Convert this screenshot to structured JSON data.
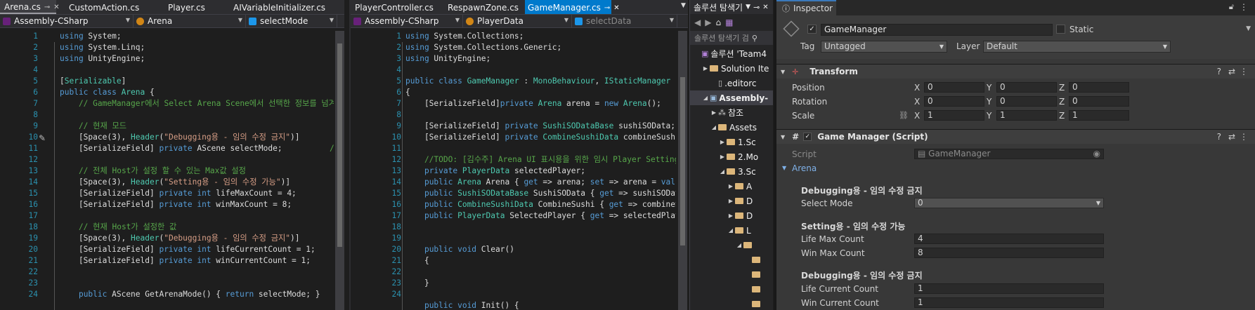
{
  "left_editor": {
    "tabs": [
      {
        "label": "Arena.cs",
        "active": true
      },
      {
        "label": "CustomAction.cs"
      },
      {
        "label": "Player.cs"
      },
      {
        "label": "AIVariableInitializer.cs"
      }
    ],
    "nav": {
      "project": "Assembly-CSharp",
      "class": "Arena",
      "member": "selectMode"
    },
    "line_numbers": [
      "1",
      "2",
      "3",
      "4",
      "5",
      "6",
      "7",
      "8",
      "9",
      "10",
      "11",
      "12",
      "13",
      "14",
      "15",
      "16",
      "17",
      "18",
      "19",
      "20",
      "21",
      "22",
      "23",
      "24"
    ],
    "lines": [
      [
        [
          "using",
          "kw"
        ],
        [
          " System;",
          "t"
        ]
      ],
      [
        [
          "using",
          "kw"
        ],
        [
          " System.Linq;",
          "t"
        ]
      ],
      [
        [
          "using",
          "kw"
        ],
        [
          " UnityEngine;",
          "t"
        ]
      ],
      [
        [
          "",
          "t"
        ]
      ],
      [
        [
          "[",
          "t"
        ],
        [
          "Serializable",
          "ty"
        ],
        [
          "]",
          "t"
        ]
      ],
      [
        [
          "public class ",
          "kw"
        ],
        [
          "Arena",
          "ty"
        ],
        [
          " {",
          "t"
        ]
      ],
      [
        [
          "    // GameManager에서 Select Arena Scene에서 선택한 정보를 넘겨",
          "cm"
        ]
      ],
      [
        [
          "",
          "t"
        ]
      ],
      [
        [
          "    // 현재 모드",
          "cm"
        ]
      ],
      [
        [
          "    [Space(3), ",
          "t"
        ],
        [
          "Header",
          "ty"
        ],
        [
          "(",
          "t"
        ],
        [
          "\"Debugging용 - 임의 수정 금지\"",
          "st"
        ],
        [
          ")]",
          "t"
        ]
      ],
      [
        [
          "    [SerializeField] ",
          "t"
        ],
        [
          "private",
          "kw"
        ],
        [
          " AScene selectMode;          ",
          "t"
        ],
        [
          "// 현재",
          "cm"
        ]
      ],
      [
        [
          "",
          "t"
        ]
      ],
      [
        [
          "    // 전체 Host가 설정 할 수 있는 Max값 설정",
          "cm"
        ]
      ],
      [
        [
          "    [Space(3), ",
          "t"
        ],
        [
          "Header",
          "ty"
        ],
        [
          "(",
          "t"
        ],
        [
          "\"Setting용 - 임의 수정 가능\"",
          "st"
        ],
        [
          ")]",
          "t"
        ]
      ],
      [
        [
          "    [SerializeField] ",
          "t"
        ],
        [
          "private int",
          "kw"
        ],
        [
          " lifeMaxCount = 4;",
          "t"
        ]
      ],
      [
        [
          "    [SerializeField] ",
          "t"
        ],
        [
          "private int",
          "kw"
        ],
        [
          " winMaxCount = 8;",
          "t"
        ]
      ],
      [
        [
          "",
          "t"
        ]
      ],
      [
        [
          "    // 현재 Host가 설정한 값",
          "cm"
        ]
      ],
      [
        [
          "    [Space(3), ",
          "t"
        ],
        [
          "Header",
          "ty"
        ],
        [
          "(",
          "t"
        ],
        [
          "\"Debugging용 - 임의 수정 금지\"",
          "st"
        ],
        [
          ")]",
          "t"
        ]
      ],
      [
        [
          "    [SerializeField] ",
          "t"
        ],
        [
          "private int",
          "kw"
        ],
        [
          " lifeCurrentCount = 1;",
          "t"
        ]
      ],
      [
        [
          "    [SerializeField] ",
          "t"
        ],
        [
          "private int",
          "kw"
        ],
        [
          " winCurrentCount = 1;",
          "t"
        ]
      ],
      [
        [
          "",
          "t"
        ]
      ],
      [
        [
          "",
          "t"
        ]
      ],
      [
        [
          "    ",
          "t"
        ],
        [
          "public",
          "kw"
        ],
        [
          " AScene GetArenaMode() { ",
          "t"
        ],
        [
          "return",
          "kw"
        ],
        [
          " selectMode; }",
          "t"
        ]
      ]
    ]
  },
  "right_editor": {
    "tabs": [
      {
        "label": "PlayerController.cs"
      },
      {
        "label": "RespawnZone.cs"
      },
      {
        "label": "GameManager.cs",
        "active": true
      }
    ],
    "nav": {
      "project": "Assembly-CSharp",
      "class": "PlayerData",
      "member": "selectData"
    },
    "line_numbers": [
      "1",
      "2",
      "3",
      "4",
      "5",
      "6",
      "7",
      "8",
      "9",
      "10",
      "11",
      "12",
      "13",
      "14",
      "15",
      "16",
      "17",
      "18",
      "19",
      "20",
      "21",
      "22",
      "23",
      "24"
    ],
    "lines": [
      [
        [
          "using",
          "kw"
        ],
        [
          " System.Collections;",
          "t"
        ]
      ],
      [
        [
          "using",
          "kw"
        ],
        [
          " System.Collections.Generic;",
          "t"
        ]
      ],
      [
        [
          "using",
          "kw"
        ],
        [
          " UnityEngine;",
          "t"
        ]
      ],
      [
        [
          "",
          "t"
        ]
      ],
      [
        [
          "public class ",
          "kw"
        ],
        [
          "GameManager",
          "ty"
        ],
        [
          " : ",
          "t"
        ],
        [
          "MonoBehaviour",
          "ty"
        ],
        [
          ", ",
          "t"
        ],
        [
          "IStaticManager",
          "ty"
        ]
      ],
      [
        [
          "{",
          "t"
        ]
      ],
      [
        [
          "    [SerializeField]",
          "t"
        ],
        [
          "private",
          "kw"
        ],
        [
          " ",
          "t"
        ],
        [
          "Arena",
          "ty"
        ],
        [
          " arena = ",
          "t"
        ],
        [
          "new",
          "kw"
        ],
        [
          " ",
          "t"
        ],
        [
          "Arena",
          "ty"
        ],
        [
          "();",
          "t"
        ]
      ],
      [
        [
          "",
          "t"
        ]
      ],
      [
        [
          "    [SerializeField] ",
          "t"
        ],
        [
          "private",
          "kw"
        ],
        [
          " ",
          "t"
        ],
        [
          "SushiSODataBase",
          "ty"
        ],
        [
          " sushiSOData;",
          "t"
        ]
      ],
      [
        [
          "    [SerializeField] ",
          "t"
        ],
        [
          "private",
          "kw"
        ],
        [
          " ",
          "t"
        ],
        [
          "CombineSushiData",
          "ty"
        ],
        [
          " combineSushi;",
          "t"
        ]
      ],
      [
        [
          "",
          "t"
        ]
      ],
      [
        [
          "    //TODO: [김수주] Arena UI 표시용을 위한 임시 Player Setting",
          "cm"
        ]
      ],
      [
        [
          "    ",
          "t"
        ],
        [
          "private",
          "kw"
        ],
        [
          " ",
          "t"
        ],
        [
          "PlayerData",
          "ty"
        ],
        [
          " selectedPlayer;",
          "t"
        ]
      ],
      [
        [
          "    ",
          "t"
        ],
        [
          "public",
          "kw"
        ],
        [
          " ",
          "t"
        ],
        [
          "Arena",
          "ty"
        ],
        [
          " Arena { ",
          "t"
        ],
        [
          "get",
          "kw"
        ],
        [
          " => arena; ",
          "t"
        ],
        [
          "set",
          "kw"
        ],
        [
          " => arena = ",
          "t"
        ],
        [
          "value",
          "kw"
        ],
        [
          "; }",
          "t"
        ]
      ],
      [
        [
          "    ",
          "t"
        ],
        [
          "public",
          "kw"
        ],
        [
          " ",
          "t"
        ],
        [
          "SushiSODataBase",
          "ty"
        ],
        [
          " SushiSOData { ",
          "t"
        ],
        [
          "get",
          "kw"
        ],
        [
          " => sushiSOData; }",
          "t"
        ]
      ],
      [
        [
          "    ",
          "t"
        ],
        [
          "public",
          "kw"
        ],
        [
          " ",
          "t"
        ],
        [
          "CombineSushiData",
          "ty"
        ],
        [
          " CombineSushi { ",
          "t"
        ],
        [
          "get",
          "kw"
        ],
        [
          " => combineSushi;",
          "t"
        ]
      ],
      [
        [
          "    ",
          "t"
        ],
        [
          "public",
          "kw"
        ],
        [
          " ",
          "t"
        ],
        [
          "PlayerData",
          "ty"
        ],
        [
          " SelectedPlayer { ",
          "t"
        ],
        [
          "get",
          "kw"
        ],
        [
          " => selectedPlayer; ",
          "t"
        ]
      ],
      [
        [
          "",
          "t"
        ]
      ],
      [
        [
          "",
          "t"
        ]
      ],
      [
        [
          "    ",
          "t"
        ],
        [
          "public void",
          "kw"
        ],
        [
          " Clear()",
          "t"
        ]
      ],
      [
        [
          "    {",
          "t"
        ]
      ],
      [
        [
          "",
          "t"
        ]
      ],
      [
        [
          "    }",
          "t"
        ]
      ],
      [
        [
          "",
          "t"
        ]
      ],
      [
        [
          "    ",
          "t"
        ],
        [
          "public void",
          "kw"
        ],
        [
          " Init() {",
          "t"
        ]
      ]
    ]
  },
  "solution_explorer": {
    "title": "솔루션 탐색기",
    "search_placeholder": "솔루션 탐색기 검",
    "rows": [
      {
        "label": "솔루션 'Team4",
        "indent": 0,
        "icon": "solution"
      },
      {
        "label": "Solution Ite",
        "indent": 1,
        "icon": "folder",
        "tri": "▶"
      },
      {
        "label": ".editorc",
        "indent": 2,
        "icon": "file"
      },
      {
        "label": "Assembly-",
        "indent": 1,
        "icon": "project",
        "tri": "◢",
        "selected": true
      },
      {
        "label": "참조",
        "indent": 2,
        "icon": "ref",
        "tri": "▶"
      },
      {
        "label": "Assets",
        "indent": 2,
        "icon": "folder",
        "tri": "◢"
      },
      {
        "label": "1.Sc",
        "indent": 3,
        "icon": "folder",
        "tri": "▶"
      },
      {
        "label": "2.Mo",
        "indent": 3,
        "icon": "folder",
        "tri": "▶"
      },
      {
        "label": "3.Sc",
        "indent": 3,
        "icon": "folder",
        "tri": "◢"
      },
      {
        "label": "A",
        "indent": 4,
        "icon": "folder",
        "tri": "▶"
      },
      {
        "label": "D",
        "indent": 4,
        "icon": "folder",
        "tri": "▶"
      },
      {
        "label": "D",
        "indent": 4,
        "icon": "folder",
        "tri": "▶"
      },
      {
        "label": "L",
        "indent": 4,
        "icon": "folder",
        "tri": "◢"
      },
      {
        "label": "",
        "indent": 5,
        "icon": "folder",
        "tri": "◢"
      },
      {
        "label": "",
        "indent": 6,
        "icon": "folder"
      },
      {
        "label": "",
        "indent": 6,
        "icon": "folder"
      },
      {
        "label": "",
        "indent": 6,
        "icon": "folder"
      },
      {
        "label": "",
        "indent": 6,
        "icon": "folder"
      }
    ]
  },
  "inspector": {
    "tab": "Inspector",
    "object_name": "GameManager",
    "static_label": "Static",
    "tag_label": "Tag",
    "tag_value": "Untagged",
    "layer_label": "Layer",
    "layer_value": "Default",
    "transform": {
      "title": "Transform",
      "rows": [
        {
          "label": "Position",
          "x": "0",
          "y": "0",
          "z": "0"
        },
        {
          "label": "Rotation",
          "x": "0",
          "y": "0",
          "z": "0"
        },
        {
          "label": "Scale",
          "x": "1",
          "y": "1",
          "z": "1"
        }
      ]
    },
    "script_comp": {
      "title": "Game Manager (Script)",
      "script_label": "Script",
      "script_value": "GameManager",
      "arena_label": "Arena",
      "header1": "Debugging용 - 임의 수정 금지",
      "select_mode_label": "Select Mode",
      "select_mode_value": "0",
      "header2": "Setting용 - 임의 수정 가능",
      "life_max_label": "Life Max Count",
      "life_max_value": "4",
      "win_max_label": "Win Max Count",
      "win_max_value": "8",
      "header3": "Debugging용 - 임의 수정 금지",
      "life_cur_label": "Life Current Count",
      "life_cur_value": "1",
      "win_cur_label": "Win Current Count",
      "win_cur_value": "1"
    }
  },
  "colors": {
    "keyword": "#569cd6",
    "type": "#4ec9b0",
    "string": "#d69d85",
    "comment": "#57a64a",
    "accent": "#007acc"
  }
}
